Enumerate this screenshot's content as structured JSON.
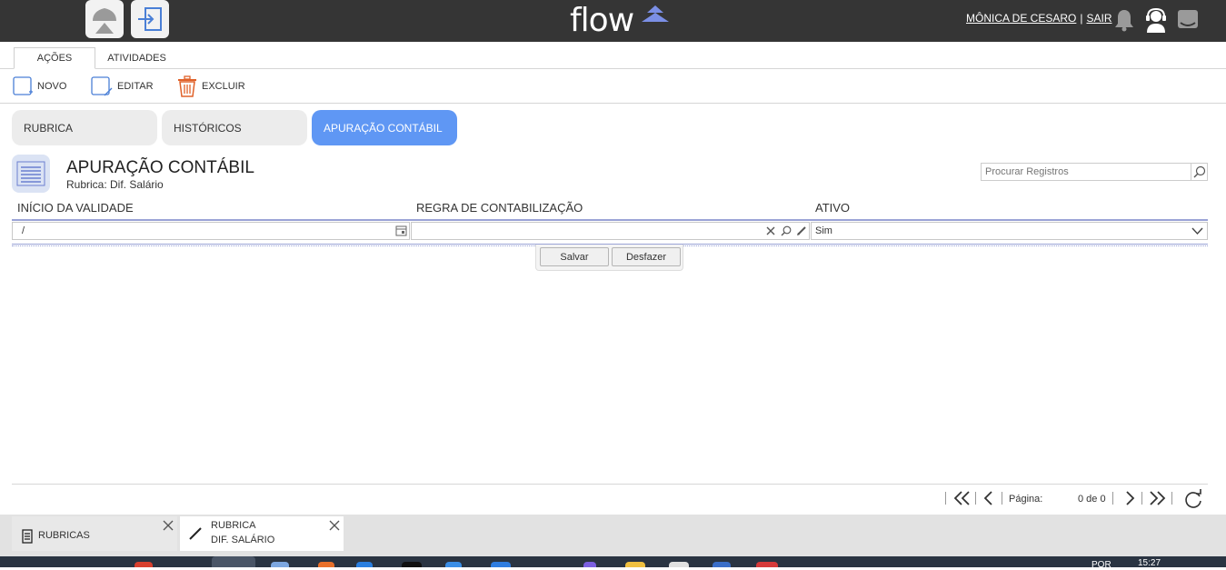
{
  "header": {
    "logo_text": "flow",
    "user_name": "MÔNICA DE CESARO",
    "separator": "|",
    "logout_label": "SAIR"
  },
  "tabs": [
    {
      "label": "AÇÕES"
    },
    {
      "label": "ATIVIDADES"
    }
  ],
  "toolbar": {
    "new_label": "NOVO",
    "edit_label": "EDITAR",
    "delete_label": "EXCLUIR"
  },
  "subtabs": [
    {
      "label": "RUBRICA"
    },
    {
      "label": "HISTÓRICOS"
    },
    {
      "label": "APURAÇÃO CONTÁBIL"
    }
  ],
  "form": {
    "title": "APURAÇÃO CONTÁBIL",
    "subtitle": "Rubrica: Dif. Salário",
    "search_placeholder": "Procurar Registros"
  },
  "grid": {
    "columns": [
      {
        "label": "INÍCIO DA VALIDADE"
      },
      {
        "label": "REGRA DE CONTABILIZAÇÃO"
      },
      {
        "label": "ATIVO"
      }
    ],
    "row": {
      "start_date": "/",
      "rule": "",
      "active": "Sim"
    },
    "save_label": "Salvar",
    "undo_label": "Desfazer"
  },
  "pager": {
    "page_label": "Página:",
    "page_value": "0 de 0"
  },
  "bottom_tabs": [
    {
      "line1": "RUBRICAS",
      "line2": ""
    },
    {
      "line1": "RUBRICA",
      "line2": "DIF. SALÁRIO"
    }
  ],
  "taskbar": {
    "lang": "POR",
    "time": "15:27"
  },
  "colors": {
    "topbar": "#353535",
    "accent": "#5f97f4",
    "logo_mark": "#7b8fe6",
    "delete": "#e0622a"
  }
}
